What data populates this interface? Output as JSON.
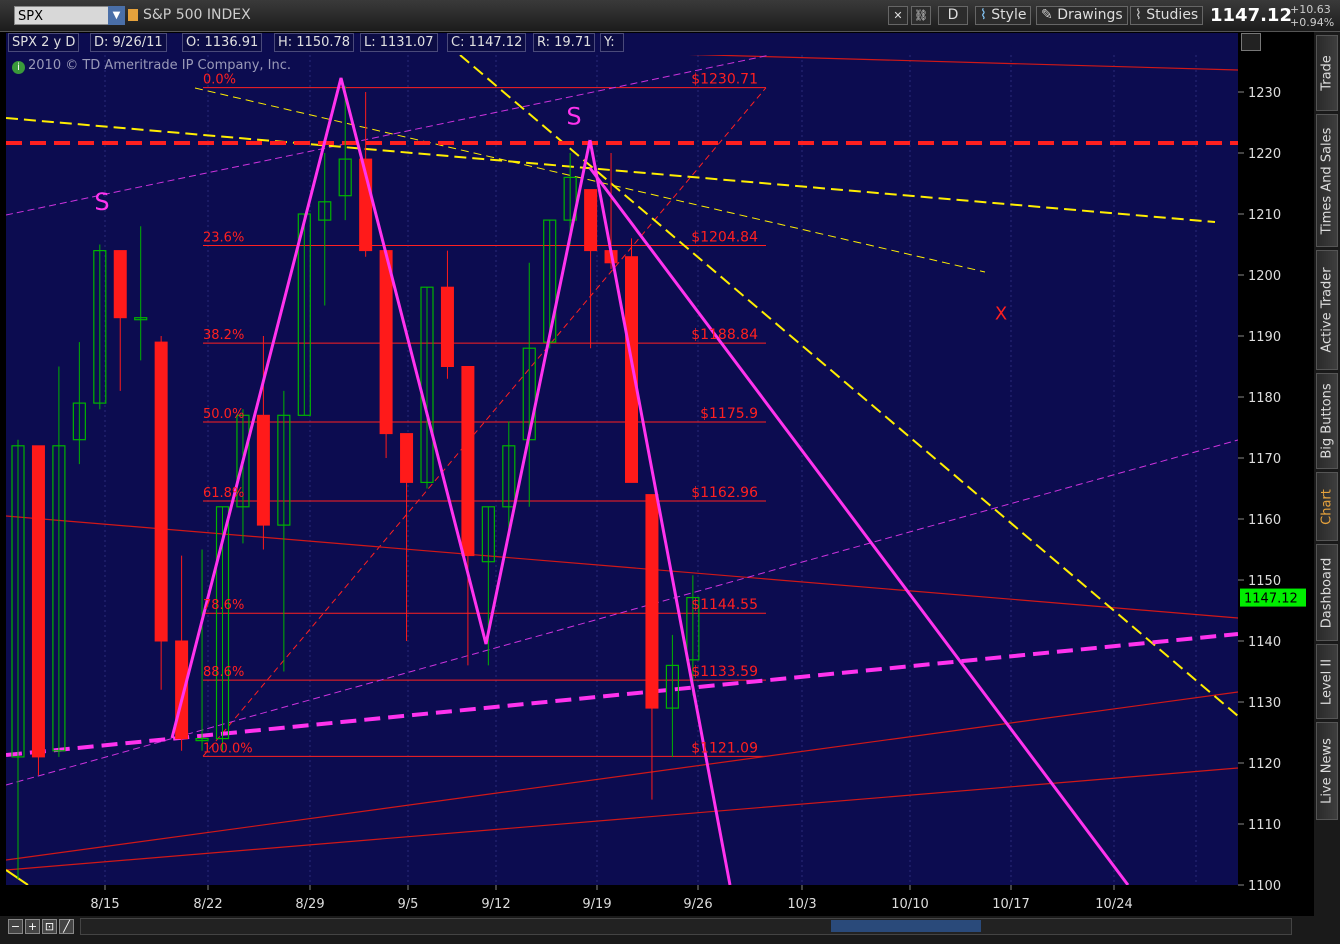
{
  "header": {
    "symbol": "SPX",
    "name": "S&P 500 INDEX",
    "period_btn": "D",
    "style_label": "Style",
    "drawings_label": "Drawings",
    "studies_label": "Studies",
    "last_price": "1147.12",
    "change_abs": "+10.63",
    "change_pct": "+0.94%"
  },
  "infobar": {
    "title": "SPX 2 y D",
    "date": "D: 9/26/11",
    "open": "O: 1136.91",
    "high": "H: 1150.78",
    "low": "L: 1131.07",
    "close": "C: 1147.12",
    "range": "R: 19.71",
    "y": "Y:"
  },
  "copyright": "2010 © TD Ameritrade IP Company, Inc.",
  "side_tabs": [
    "Trade",
    "Times And Sales",
    "Active Trader",
    "Big Buttons",
    "Chart",
    "Dashboard",
    "Level II",
    "Live News"
  ],
  "active_tab": "Chart",
  "chart_data": {
    "type": "candlestick",
    "x_tick_labels": [
      "8/15",
      "8/22",
      "8/29",
      "9/5",
      "9/12",
      "9/19",
      "9/26",
      "10/3",
      "10/10",
      "10/17",
      "10/24"
    ],
    "y_ticks": [
      1100,
      1110,
      1120,
      1130,
      1140,
      1150,
      1160,
      1170,
      1180,
      1190,
      1200,
      1210,
      1220,
      1230
    ],
    "ylim": [
      1097,
      1240
    ],
    "price_label": "1147.12",
    "candles": [
      {
        "d": "8/9",
        "o": 1121,
        "h": 1173,
        "l": 1101,
        "c": 1172
      },
      {
        "d": "8/10",
        "o": 1172,
        "h": 1172,
        "l": 1118,
        "c": 1121
      },
      {
        "d": "8/11",
        "o": 1122,
        "h": 1185,
        "l": 1121,
        "c": 1172
      },
      {
        "d": "8/12",
        "o": 1173,
        "h": 1189,
        "l": 1169,
        "c": 1179
      },
      {
        "d": "8/15",
        "o": 1179,
        "h": 1205,
        "l": 1178,
        "c": 1204
      },
      {
        "d": "8/16",
        "o": 1204,
        "h": 1204,
        "l": 1181,
        "c": 1193
      },
      {
        "d": "8/17",
        "o": 1193,
        "h": 1208,
        "l": 1186,
        "c": 1193
      },
      {
        "d": "8/18",
        "o": 1189,
        "h": 1190,
        "l": 1132,
        "c": 1140
      },
      {
        "d": "8/19",
        "o": 1140,
        "h": 1154,
        "l": 1122,
        "c": 1124
      },
      {
        "d": "8/22",
        "o": 1124,
        "h": 1155,
        "l": 1122,
        "c": 1124
      },
      {
        "d": "8/23",
        "o": 1124,
        "h": 1162,
        "l": 1122,
        "c": 1162
      },
      {
        "d": "8/24",
        "o": 1162,
        "h": 1178,
        "l": 1156,
        "c": 1177
      },
      {
        "d": "8/25",
        "o": 1177,
        "h": 1190,
        "l": 1155,
        "c": 1159
      },
      {
        "d": "8/26",
        "o": 1159,
        "h": 1181,
        "l": 1135,
        "c": 1177
      },
      {
        "d": "8/29",
        "o": 1177,
        "h": 1210,
        "l": 1177,
        "c": 1210
      },
      {
        "d": "8/30",
        "o": 1209,
        "h": 1220,
        "l": 1195,
        "c": 1212
      },
      {
        "d": "8/31",
        "o": 1213,
        "h": 1231,
        "l": 1209,
        "c": 1219
      },
      {
        "d": "9/1",
        "o": 1219,
        "h": 1230,
        "l": 1203,
        "c": 1204
      },
      {
        "d": "9/2",
        "o": 1204,
        "h": 1204,
        "l": 1170,
        "c": 1174
      },
      {
        "d": "9/6",
        "o": 1174,
        "h": 1174,
        "l": 1140,
        "c": 1166
      },
      {
        "d": "9/7",
        "o": 1166,
        "h": 1198,
        "l": 1165,
        "c": 1198
      },
      {
        "d": "9/8",
        "o": 1198,
        "h": 1204,
        "l": 1183,
        "c": 1185
      },
      {
        "d": "9/9",
        "o": 1185,
        "h": 1185,
        "l": 1136,
        "c": 1154
      },
      {
        "d": "9/12",
        "o": 1153,
        "h": 1162,
        "l": 1136,
        "c": 1162
      },
      {
        "d": "9/13",
        "o": 1162,
        "h": 1176,
        "l": 1158,
        "c": 1172
      },
      {
        "d": "9/14",
        "o": 1173,
        "h": 1202,
        "l": 1162,
        "c": 1188
      },
      {
        "d": "9/15",
        "o": 1189,
        "h": 1209,
        "l": 1188,
        "c": 1209
      },
      {
        "d": "9/16",
        "o": 1209,
        "h": 1220,
        "l": 1205,
        "c": 1216
      },
      {
        "d": "9/19",
        "o": 1214,
        "h": 1214,
        "l": 1188,
        "c": 1204
      },
      {
        "d": "9/20",
        "o": 1204,
        "h": 1220,
        "l": 1201,
        "c": 1202
      },
      {
        "d": "9/21",
        "o": 1203,
        "h": 1206,
        "l": 1166,
        "c": 1166
      },
      {
        "d": "9/22",
        "o": 1164,
        "h": 1164,
        "l": 1114,
        "c": 1129
      },
      {
        "d": "9/23",
        "o": 1129,
        "h": 1141,
        "l": 1121,
        "c": 1136
      },
      {
        "d": "9/26",
        "o": 1136.91,
        "h": 1150.78,
        "l": 1131.07,
        "c": 1147.12
      }
    ],
    "fib_levels": [
      {
        "pct": "0.0%",
        "price": "$1230.71",
        "value": 1230.71
      },
      {
        "pct": "23.6%",
        "price": "$1204.84",
        "value": 1204.84
      },
      {
        "pct": "38.2%",
        "price": "$1188.84",
        "value": 1188.84
      },
      {
        "pct": "50.0%",
        "price": "$1175.9",
        "value": 1175.9
      },
      {
        "pct": "61.8%",
        "price": "$1162.96",
        "value": 1162.96
      },
      {
        "pct": "78.6%",
        "price": "$1144.55",
        "value": 1144.55
      },
      {
        "pct": "88.6%",
        "price": "$1133.59",
        "value": 1133.59
      },
      {
        "pct": "100.0%",
        "price": "$1121.09",
        "value": 1121.09
      }
    ],
    "annotations": [
      {
        "text": "S",
        "x": "8/15",
        "y": 1212
      },
      {
        "text": "S",
        "x": "9/16",
        "y": 1226
      },
      {
        "text": "X",
        "x": "10/17",
        "y": 1194
      }
    ],
    "colors": {
      "background": "#0c0c50",
      "up": "#00b400",
      "down": "#ff1a1a",
      "fib": "#ff2020",
      "pattern": "#ff33ee",
      "trend": "#ffee00",
      "price_tag": "#00ee00"
    }
  }
}
